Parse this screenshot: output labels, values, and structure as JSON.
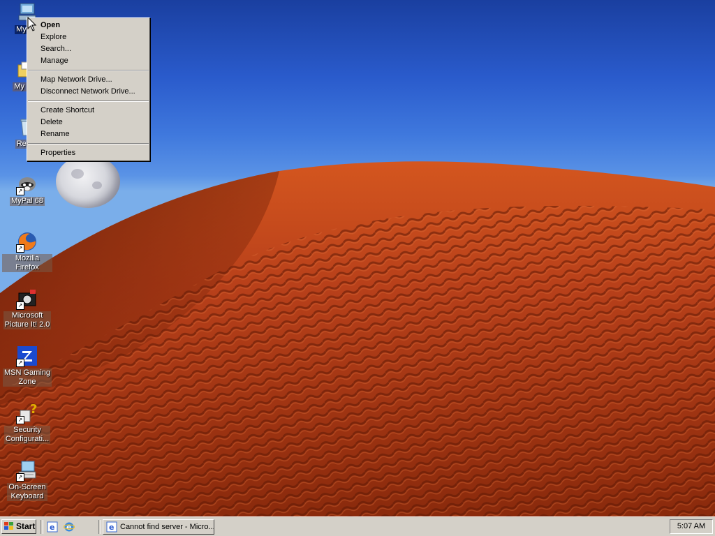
{
  "desktop": {
    "icons": [
      {
        "name": "my-computer",
        "label": "My Co",
        "icon": "computer-icon",
        "shortcut": false
      },
      {
        "name": "my-documents",
        "label": "My Doc",
        "icon": "folder-icon",
        "shortcut": false
      },
      {
        "name": "recycle-bin",
        "label": "Recyc",
        "icon": "recycle-bin-icon",
        "shortcut": false
      },
      {
        "name": "mypal",
        "label": "MyPal 68",
        "icon": "raccoon-icon",
        "shortcut": true
      },
      {
        "name": "mozilla-firefox",
        "label": "Mozilla Firefox",
        "icon": "firefox-icon",
        "shortcut": true
      },
      {
        "name": "picture-it",
        "label_line1": "Microsoft",
        "label_line2": "Picture It! 2.0",
        "icon": "camera-icon",
        "shortcut": true
      },
      {
        "name": "msn-gaming-zone",
        "label_line1": "MSN Gaming",
        "label_line2": "Zone",
        "icon": "zone-icon",
        "shortcut": true
      },
      {
        "name": "security-config",
        "label_line1": "Security",
        "label_line2": "Configurati...",
        "icon": "security-config-icon",
        "shortcut": true
      },
      {
        "name": "on-screen-keyboard",
        "label_line1": "On-Screen",
        "label_line2": "Keyboard",
        "icon": "keyboard-icon",
        "shortcut": true
      }
    ]
  },
  "context_menu": {
    "items": [
      "Open",
      "Explore",
      "Search...",
      "Manage",
      "Map Network Drive...",
      "Disconnect Network Drive...",
      "Create Shortcut",
      "Delete",
      "Rename",
      "Properties"
    ]
  },
  "taskbar": {
    "start_label": "Start",
    "quick_launch": [
      "ie-icon",
      "ie-icon-alt"
    ],
    "task_title": "Cannot find server - Micro...",
    "clock": "5:07 AM"
  },
  "colors": {
    "sky_top": "#1a3fa0",
    "sky_bottom": "#7aaeea",
    "dune": "#b8401a",
    "dune_shadow": "#6a1d08",
    "menu_bg": "#d4d0c8",
    "selection": "#0a246a"
  }
}
